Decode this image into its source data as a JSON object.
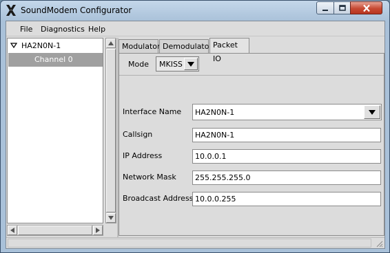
{
  "window": {
    "title": "SoundModem Configurator",
    "buttons": {
      "minimize": "minimize",
      "maximize": "maximize",
      "close": "close"
    }
  },
  "menu": [
    "File",
    "Diagnostics",
    "Help"
  ],
  "tree": {
    "root": "HA2N0N-1",
    "child": "Channel 0"
  },
  "tabs": [
    "Modulator",
    "Demodulator",
    "Packet IO"
  ],
  "active_tab": "Packet IO",
  "mode": {
    "label": "Mode",
    "value": "MKISS"
  },
  "fields": {
    "interface_name": {
      "label": "Interface Name",
      "value": "HA2N0N-1"
    },
    "callsign": {
      "label": "Callsign",
      "value": "HA2N0N-1"
    },
    "ip_address": {
      "label": "IP Address",
      "value": "10.0.0.1"
    },
    "network_mask": {
      "label": "Network Mask",
      "value": "255.255.255.0"
    },
    "broadcast_address": {
      "label": "Broadcast Address",
      "value": "10.0.0.255"
    }
  },
  "colors": {
    "titlebar": "#a9c1d9",
    "selection": "#a0a0a0",
    "close_button": "#c74a33"
  }
}
